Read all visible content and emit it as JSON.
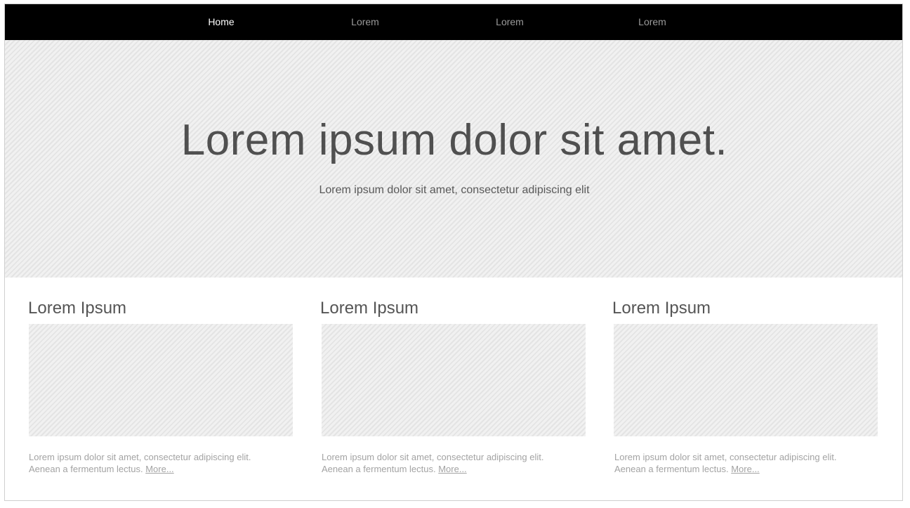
{
  "nav": {
    "items": [
      {
        "label": "Home",
        "active": true
      },
      {
        "label": "Lorem",
        "active": false
      },
      {
        "label": "Lorem",
        "active": false
      },
      {
        "label": "Lorem",
        "active": false
      }
    ]
  },
  "hero": {
    "title": "Lorem ipsum dolor sit amet.",
    "subtitle": "Lorem ipsum dolor sit amet, consectetur adipiscing elit"
  },
  "cards": [
    {
      "title": "Lorem Ipsum",
      "text_line1": "Lorem ipsum dolor sit amet, consectetur adipiscing elit.",
      "text_line2": "Aenean a fermentum lectus.",
      "more_label": "More..."
    },
    {
      "title": "Lorem Ipsum",
      "text_line1": "Lorem ipsum dolor sit amet, consectetur adipiscing elit.",
      "text_line2": "Aenean a fermentum lectus.",
      "more_label": "More..."
    },
    {
      "title": "Lorem Ipsum",
      "text_line1": "Lorem ipsum dolor sit amet, consectetur adipiscing elit.",
      "text_line2": "Aenean a fermentum lectus.",
      "more_label": "More..."
    }
  ],
  "colors": {
    "nav_background": "#000000",
    "nav_active_text": "#ffffff",
    "nav_inactive_text": "#9a9a9a",
    "hero_background": "#ececec",
    "title_text": "#505050",
    "body_text": "#a3a3a3"
  }
}
